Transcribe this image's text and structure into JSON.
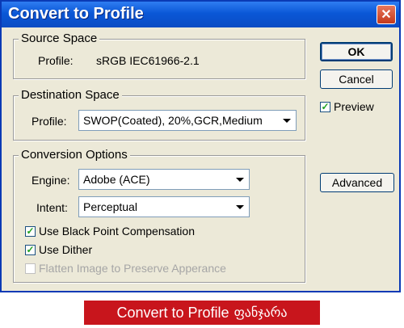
{
  "window": {
    "title": "Convert to Profile",
    "close_label": "✕"
  },
  "source_space": {
    "group_title": "Source Space",
    "profile_label": "Profile:",
    "profile_value": "sRGB IEC61966-2.1"
  },
  "destination_space": {
    "group_title": "Destination Space",
    "profile_label": "Profile:",
    "profile_value": "SWOP(Coated), 20%,GCR,Medium"
  },
  "conversion_options": {
    "group_title": "Conversion Options",
    "engine_label": "Engine:",
    "engine_value": "Adobe (ACE)",
    "intent_label": "Intent:",
    "intent_value": "Perceptual",
    "black_point": {
      "label": "Use Black Point Compensation",
      "checked": true
    },
    "dither": {
      "label": "Use Dither",
      "checked": true
    },
    "flatten": {
      "label": "Flatten Image to Preserve Apperance",
      "checked": false,
      "enabled": false
    }
  },
  "buttons": {
    "ok": "OK",
    "cancel": "Cancel",
    "advanced": "Advanced"
  },
  "preview": {
    "label": "Preview",
    "checked": true
  },
  "caption": {
    "main": "Convert to Profile",
    "suffix": "ფანჯარა"
  },
  "colors": {
    "titlebar": "#0a57d6",
    "caption_bg": "#c8151c",
    "dialog_bg": "#ece9d8"
  }
}
